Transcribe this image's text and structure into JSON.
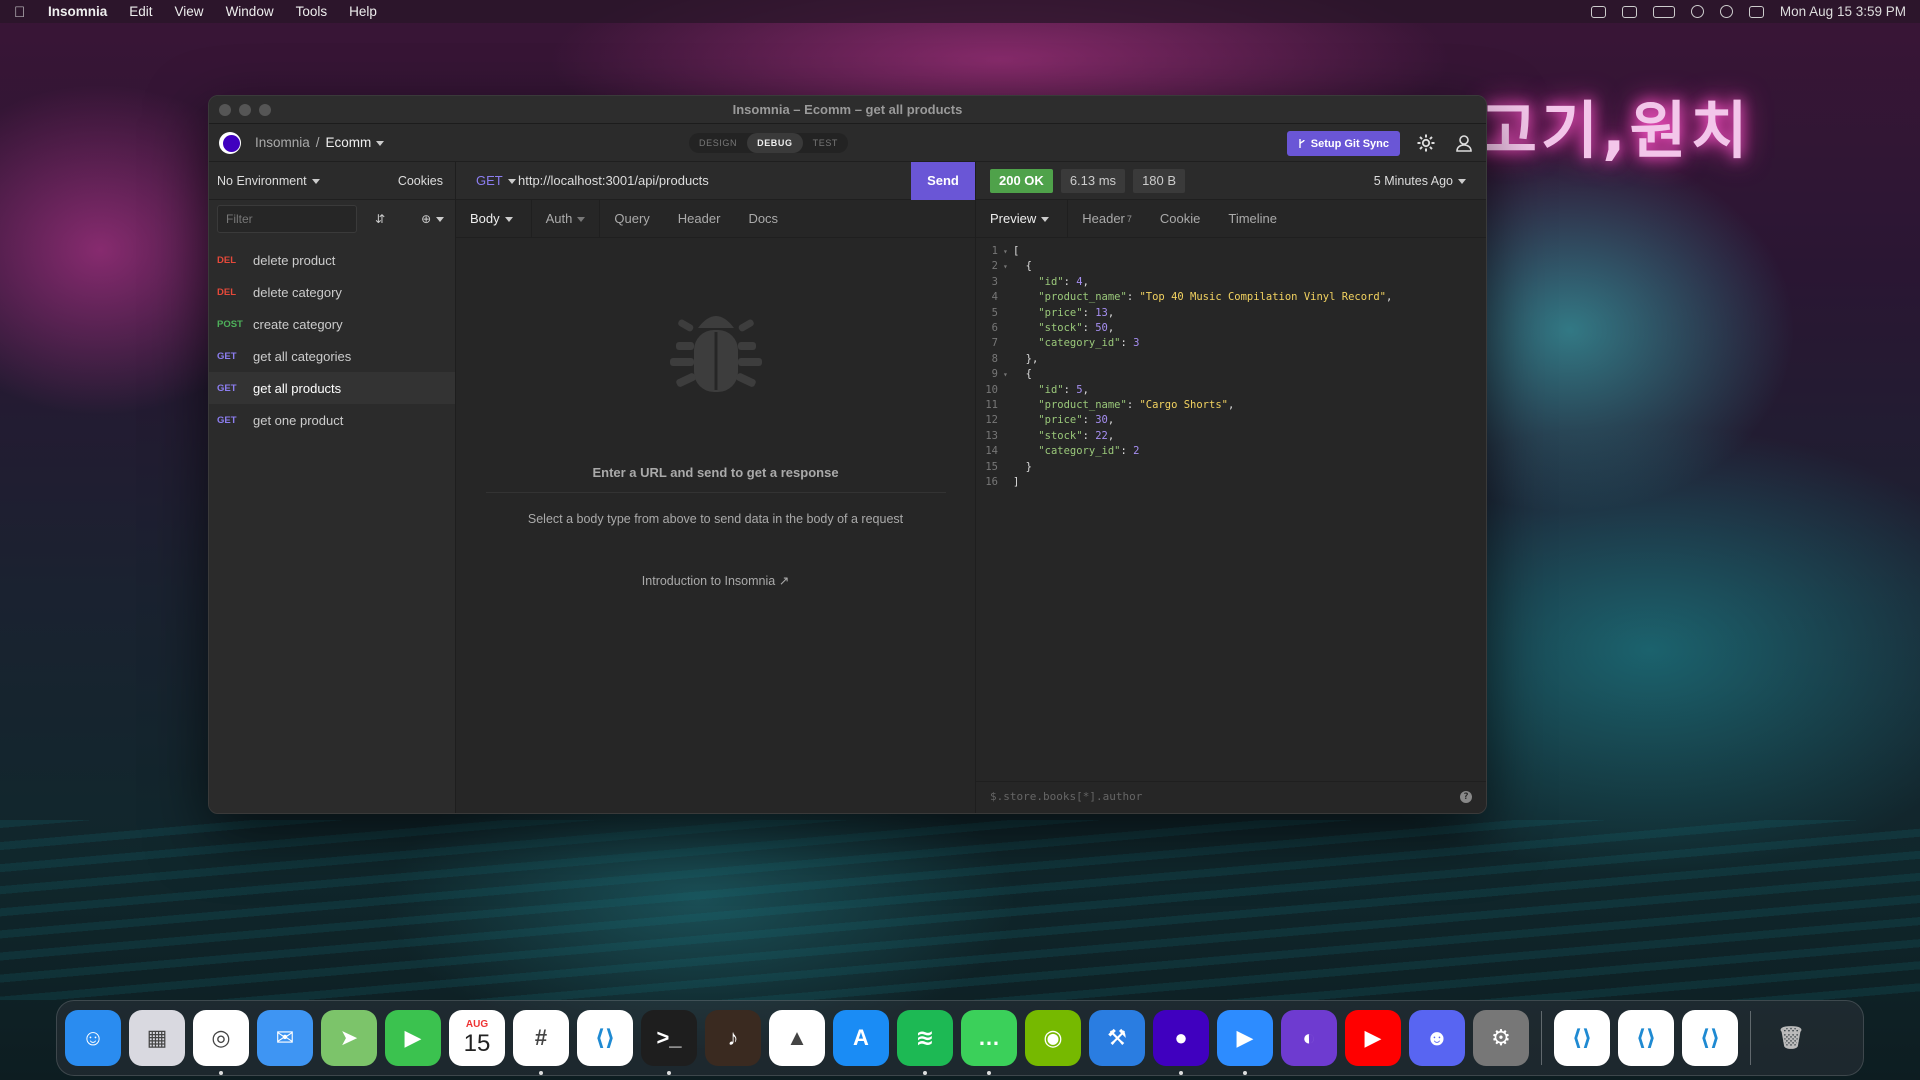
{
  "menubar": {
    "app_name": "Insomnia",
    "items": [
      "Edit",
      "View",
      "Window",
      "Tools",
      "Help"
    ],
    "datetime": "Mon Aug 15  3:59 PM"
  },
  "wallpaper": {
    "sign_text": "고기,원치"
  },
  "window": {
    "title": "Insomnia – Ecomm – get all products",
    "breadcrumb_root": "Insomnia",
    "breadcrumb_sep": "/",
    "project": "Ecomm",
    "modes": [
      "DESIGN",
      "DEBUG",
      "TEST"
    ],
    "active_mode": "DEBUG",
    "git_sync_label": "Setup Git Sync"
  },
  "sidebar": {
    "environment": "No Environment",
    "cookies": "Cookies",
    "filter_placeholder": "Filter",
    "requests": [
      {
        "method": "DEL",
        "name": "delete product"
      },
      {
        "method": "DEL",
        "name": "delete category"
      },
      {
        "method": "POST",
        "name": "create category"
      },
      {
        "method": "GET",
        "name": "get all categories"
      },
      {
        "method": "GET",
        "name": "get all products"
      },
      {
        "method": "GET",
        "name": "get one product"
      }
    ],
    "active_index": 4
  },
  "request": {
    "method": "GET",
    "url": "http://localhost:3001/api/products",
    "send_label": "Send",
    "tabs": [
      "Body",
      "Auth",
      "Query",
      "Header",
      "Docs"
    ],
    "empty_title": "Enter a URL and send to get a response",
    "empty_sub": "Select a body type from above to send data in the body of a request",
    "intro_link": "Introduction to Insomnia"
  },
  "response": {
    "status": "200 OK",
    "time": "6.13 ms",
    "size": "180 B",
    "ago": "5 Minutes Ago",
    "tabs": [
      "Preview",
      "Header",
      "Cookie",
      "Timeline"
    ],
    "header_count": "7",
    "filter_placeholder": "$.store.books[*].author",
    "help": "?"
  },
  "code_lines": [
    "[",
    "  {",
    "    \"id\": 4,",
    "    \"product_name\": \"Top 40 Music Compilation Vinyl Record\",",
    "    \"price\": 13,",
    "    \"stock\": 50,",
    "    \"category_id\": 3",
    "  },",
    "  {",
    "    \"id\": 5,",
    "    \"product_name\": \"Cargo Shorts\",",
    "    \"price\": 30,",
    "    \"stock\": 22,",
    "    \"category_id\": 2",
    "  }",
    "]"
  ],
  "dock": {
    "apps": [
      {
        "name": "Finder",
        "color": "#2a8cf0"
      },
      {
        "name": "Launchpad",
        "color": "#d9d9e0"
      },
      {
        "name": "Chrome",
        "color": "#ffffff"
      },
      {
        "name": "Mail",
        "color": "#3e95f3"
      },
      {
        "name": "Maps",
        "color": "#7cc46a"
      },
      {
        "name": "FaceTime",
        "color": "#3bc24f"
      },
      {
        "name": "Calendar",
        "color": "#ffffff"
      },
      {
        "name": "Slack",
        "color": "#ffffff"
      },
      {
        "name": "VS Code",
        "color": "#ffffff"
      },
      {
        "name": "Terminal",
        "color": "#1e1e1e"
      },
      {
        "name": "GarageBand",
        "color": "#3a2a20"
      },
      {
        "name": "Google Drive",
        "color": "#ffffff"
      },
      {
        "name": "App Store",
        "color": "#1a8cf5"
      },
      {
        "name": "Spotify",
        "color": "#1db954"
      },
      {
        "name": "Messages",
        "color": "#3bd05a"
      },
      {
        "name": "NVIDIA",
        "color": "#76b900"
      },
      {
        "name": "Xcode",
        "color": "#2a7de1"
      },
      {
        "name": "Insomnia",
        "color": "#4000bf"
      },
      {
        "name": "Zoom",
        "color": "#2d8cff"
      },
      {
        "name": "GitHub Desktop",
        "color": "#6e3bd0"
      },
      {
        "name": "YouTube",
        "color": "#ff0000"
      },
      {
        "name": "Discord",
        "color": "#5865f2"
      },
      {
        "name": "System Preferences",
        "color": "#777777"
      }
    ],
    "calendar_month": "AUG",
    "calendar_day": "15",
    "recent": [
      "VS Code",
      "VS Code",
      "VS Code"
    ]
  }
}
